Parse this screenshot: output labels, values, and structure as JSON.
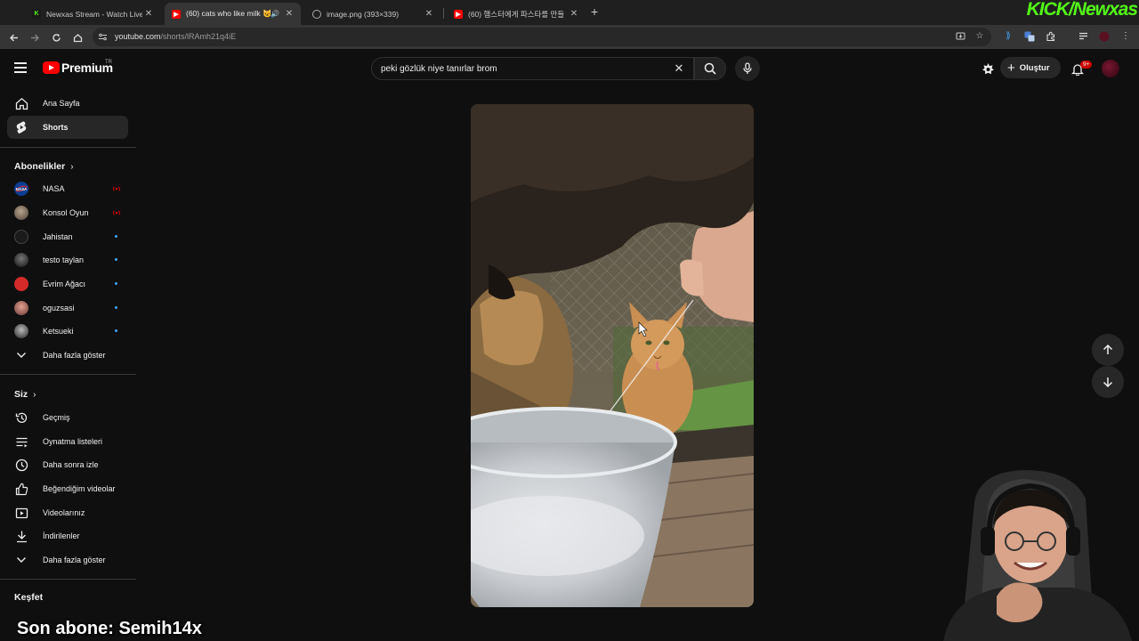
{
  "browser": {
    "tabs": [
      {
        "title": "Newxas Stream - Watch Live on",
        "favicon": "kick-icon"
      },
      {
        "title": "(60) cats who like milk 😺🥛",
        "favicon": "youtube-icon",
        "active": true
      },
      {
        "title": "image.png (393×339)",
        "favicon": "globe-icon"
      },
      {
        "title": "(60) 햄스터에게 파스타를 만들",
        "favicon": "youtube-icon"
      }
    ],
    "url_host": "youtube.com",
    "url_path": "/shorts/lRAmh21q4iE"
  },
  "stream_overlay": {
    "kick_logo": "KICK/Newxas",
    "last_sub_text": "Son abone: Semih14x"
  },
  "masthead": {
    "logo_text": "Premium",
    "country_code": "TR",
    "search_value": "peki gözlük niye tanırlar brom",
    "create_label": "Oluştur",
    "notification_count": "9+"
  },
  "sidebar": {
    "main_items": [
      {
        "label": "Ana Sayfa",
        "icon": "home-icon"
      },
      {
        "label": "Shorts",
        "icon": "shorts-icon",
        "active": true
      }
    ],
    "subscriptions_header": "Abonelikler",
    "subscriptions": [
      {
        "label": "NASA",
        "status": "live"
      },
      {
        "label": "Konsol Oyun",
        "status": "live"
      },
      {
        "label": "Jahistan",
        "status": "new"
      },
      {
        "label": "testo taylan",
        "status": "new"
      },
      {
        "label": "Evrim Ağacı",
        "status": "new"
      },
      {
        "label": "oguzsasi",
        "status": "new"
      },
      {
        "label": "Ketsueki",
        "status": "new"
      }
    ],
    "subs_more": "Daha fazla göster",
    "you_header": "Siz",
    "you_items": [
      {
        "label": "Geçmiş",
        "icon": "history-icon"
      },
      {
        "label": "Oynatma listeleri",
        "icon": "playlists-icon"
      },
      {
        "label": "Daha sonra izle",
        "icon": "watch-later-icon"
      },
      {
        "label": "Beğendiğim videolar",
        "icon": "like-icon"
      },
      {
        "label": "Videolarınız",
        "icon": "your-videos-icon"
      },
      {
        "label": "İndirilenler",
        "icon": "downloads-icon"
      }
    ],
    "you_more": "Daha fazla göster",
    "explore_header": "Keşfet"
  },
  "colors": {
    "background": "#0f0f0f",
    "youtube_red": "#ff0000",
    "kick_green": "#53fc18",
    "live_red": "#cc0000",
    "new_dot_blue": "#3ea6ff"
  }
}
